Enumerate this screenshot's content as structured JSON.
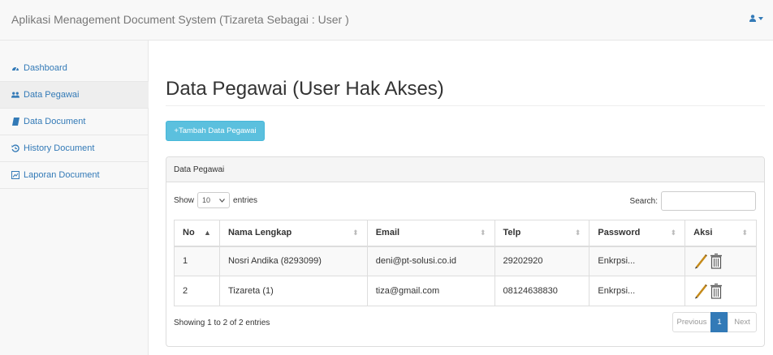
{
  "app": {
    "title": "Aplikasi Menagement Document System (Tizareta Sebagai : User )"
  },
  "colors": {
    "accent": "#337ab7",
    "add_button": "#5bc0de",
    "edit_pencil": "#c58a1a"
  },
  "sidebar": {
    "items": [
      {
        "label": "Dashboard",
        "icon": "dashboard-icon"
      },
      {
        "label": "Data Pegawai",
        "icon": "users-icon"
      },
      {
        "label": "Data Document",
        "icon": "book-icon"
      },
      {
        "label": "History Document",
        "icon": "history-icon"
      },
      {
        "label": "Laporan Document",
        "icon": "report-icon"
      }
    ]
  },
  "page": {
    "title": "Data Pegawai (User Hak Akses)",
    "add_button": "+Tambah Data Pegawai"
  },
  "panel": {
    "heading": "Data Pegawai",
    "length": {
      "prefix": "Show",
      "value": "10",
      "suffix": "entries"
    },
    "search_label": "Search:",
    "columns": [
      "No",
      "Nama Lengkap",
      "Email",
      "Telp",
      "Password",
      "Aksi"
    ],
    "rows": [
      {
        "no": "1",
        "nama": "Nosri Andika (8293099)",
        "email": "deni@pt-solusi.co.id",
        "telp": "29202920",
        "password": "Enkrpsi..."
      },
      {
        "no": "2",
        "nama": "Tizareta (1)",
        "email": "tiza@gmail.com",
        "telp": "08124638830",
        "password": "Enkrpsi..."
      }
    ],
    "info": "Showing 1 to 2 of 2 entries",
    "pagination": {
      "previous": "Previous",
      "current": "1",
      "next": "Next"
    }
  }
}
